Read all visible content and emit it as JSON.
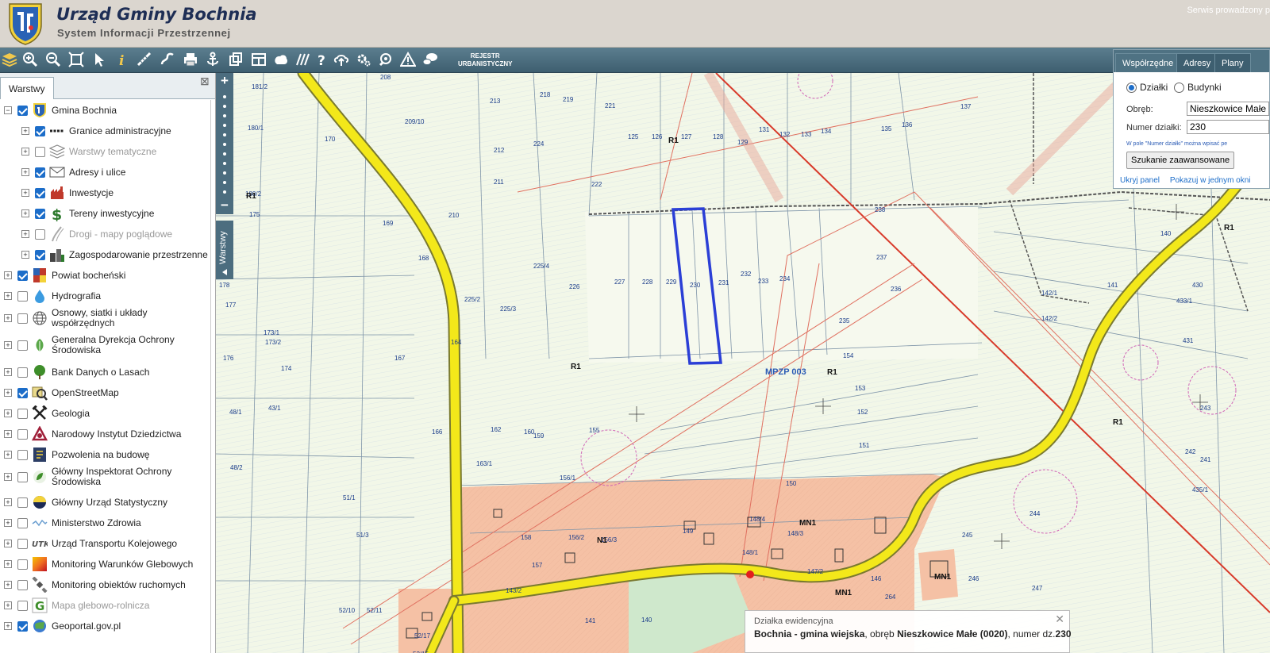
{
  "header": {
    "title": "Urząd Gminy Bochnia",
    "subtitle": "System Informacji Przestrzennej",
    "service_note": "Serwis prowadzony p"
  },
  "toolbar": {
    "tools": [
      "layers-icon",
      "zoom-in-icon",
      "zoom-out-icon",
      "zoom-extent-icon",
      "pointer-icon",
      "info-icon",
      "measure-line-icon",
      "measure-area-icon",
      "print-icon",
      "anchor-icon",
      "copy-icon",
      "table-icon",
      "cloud-shape-icon",
      "hatch-icon",
      "help-icon",
      "upload-cloud-icon",
      "settings-icon",
      "search-map-icon",
      "warning-icon",
      "chat-icon"
    ],
    "registry_line1": "REJESTR",
    "registry_line2": "URBANISTYCZNY"
  },
  "layer_panel": {
    "tab": "Warstwy",
    "close": "⊠",
    "layers": [
      {
        "label": "Gmina Bochnia",
        "checked": true,
        "level": 0,
        "expander": "−",
        "icon": "gmina-crest-icon"
      },
      {
        "label": "Granice administracyjne",
        "checked": true,
        "level": 1,
        "expander": "+",
        "icon": "boundary-line-icon"
      },
      {
        "label": "Warstwy tematyczne",
        "checked": false,
        "level": 1,
        "expander": "+",
        "icon": "layers-stack-icon",
        "grey": true
      },
      {
        "label": "Adresy i ulice",
        "checked": true,
        "level": 1,
        "expander": "+",
        "icon": "envelope-icon"
      },
      {
        "label": "Inwestycje",
        "checked": true,
        "level": 1,
        "expander": "+",
        "icon": "factory-icon"
      },
      {
        "label": "Tereny inwestycyjne",
        "checked": true,
        "level": 1,
        "expander": "+",
        "icon": "dollar-icon"
      },
      {
        "label": "Drogi - mapy poglądowe",
        "checked": false,
        "level": 1,
        "expander": "+",
        "icon": "road-icon",
        "grey": true
      },
      {
        "label": "Zagospodarowanie przestrzenne",
        "checked": true,
        "level": 1,
        "expander": "+",
        "icon": "buildings-icon"
      },
      {
        "label": "Powiat bocheński",
        "checked": true,
        "level": 0,
        "expander": "+",
        "icon": "powiat-crest-icon"
      },
      {
        "label": "Hydrografia",
        "checked": false,
        "level": 0,
        "expander": "+",
        "icon": "water-drop-icon"
      },
      {
        "label": "Osnowy, siatki i układy współrzędnych",
        "checked": false,
        "level": 0,
        "expander": "+",
        "icon": "globe-grid-icon"
      },
      {
        "label": "Generalna Dyrekcja Ochrony Środowiska",
        "checked": false,
        "level": 0,
        "expander": "+",
        "icon": "leaf-icon"
      },
      {
        "label": "Bank Danych o Lasach",
        "checked": false,
        "level": 0,
        "expander": "+",
        "icon": "tree-icon"
      },
      {
        "label": "OpenStreetMap",
        "checked": true,
        "level": 0,
        "expander": "+",
        "icon": "map-magnifier-icon"
      },
      {
        "label": "Geologia",
        "checked": false,
        "level": 0,
        "expander": "+",
        "icon": "hammers-icon"
      },
      {
        "label": "Narodowy Instytut Dziedzictwa",
        "checked": false,
        "level": 0,
        "expander": "+",
        "icon": "heritage-icon"
      },
      {
        "label": "Pozwolenia na budowę",
        "checked": false,
        "level": 0,
        "expander": "+",
        "icon": "permit-icon"
      },
      {
        "label": "Główny Inspektorat Ochrony Środowiska",
        "checked": false,
        "level": 0,
        "expander": "+",
        "icon": "gios-icon"
      },
      {
        "label": "Główny Urząd Statystyczny",
        "checked": false,
        "level": 0,
        "expander": "+",
        "icon": "gus-icon"
      },
      {
        "label": "Ministerstwo Zdrowia",
        "checked": false,
        "level": 0,
        "expander": "+",
        "icon": "wave-icon"
      },
      {
        "label": "Urząd Transportu Kolejowego",
        "checked": false,
        "level": 0,
        "expander": "+",
        "icon": "rail-icon"
      },
      {
        "label": "Monitoring Warunków Glebowych",
        "checked": false,
        "level": 0,
        "expander": "+",
        "icon": "soil-gradient-icon"
      },
      {
        "label": "Monitoring obiektów ruchomych",
        "checked": false,
        "level": 0,
        "expander": "+",
        "icon": "satellite-icon"
      },
      {
        "label": "Mapa glebowo-rolnicza",
        "checked": false,
        "level": 0,
        "expander": "+",
        "icon": "g-letter-icon",
        "grey": true
      },
      {
        "label": "Geoportal.gov.pl",
        "checked": true,
        "level": 0,
        "expander": "+",
        "icon": "geoportal-icon"
      }
    ]
  },
  "map": {
    "zoom_in": "+",
    "zoom_out": "−",
    "layers_handle": "Warstwy",
    "mpzp_label": "MPZP 003",
    "zones": [
      "R1",
      "R1",
      "R1",
      "R1",
      "R1",
      "R1",
      "N1",
      "MN1",
      "MN1",
      "MN1"
    ],
    "parcels": [
      "208",
      "181/2",
      "180/1",
      "180/2",
      "213",
      "218",
      "219",
      "221",
      "209/10",
      "212",
      "211",
      "210",
      "170",
      "175",
      "169",
      "168",
      "167",
      "164",
      "125",
      "126",
      "127",
      "128",
      "129",
      "131",
      "132",
      "133",
      "134",
      "135",
      "136",
      "137",
      "222",
      "224",
      "225/4",
      "225/2",
      "225/3",
      "226",
      "227",
      "228",
      "229",
      "230",
      "231",
      "232",
      "233",
      "234",
      "235",
      "236",
      "237",
      "238",
      "154",
      "153",
      "152",
      "151",
      "155",
      "159",
      "160",
      "162",
      "163/1",
      "166",
      "173/2",
      "173/1",
      "174",
      "176",
      "177",
      "178",
      "48/1",
      "48/2",
      "43/1",
      "51/1",
      "51/3",
      "52/10",
      "52/11",
      "52/17",
      "52/15",
      "156/1",
      "150",
      "158",
      "156/2",
      "156/3",
      "149",
      "148/4",
      "148/3",
      "148/1",
      "147/2",
      "157",
      "143/2",
      "146",
      "141",
      "140",
      "245",
      "246",
      "244",
      "247",
      "243",
      "242",
      "241",
      "140",
      "141",
      "430",
      "433/1",
      "431",
      "142/1",
      "142/2",
      "435/1",
      "264"
    ]
  },
  "search_panel": {
    "tabs": [
      "Współrzędne",
      "Adresy",
      "Plany"
    ],
    "radio_parcels": "Działki",
    "radio_buildings": "Budynki",
    "obreb_label": "Obręb:",
    "obreb_value": "Nieszkowice Małe",
    "parcel_label": "Numer działki:",
    "parcel_value": "230",
    "hint": "W pole \"Numer działki\" można wpisać pe",
    "advanced_button": "Szukanie zaawansowane",
    "hide_link": "Ukryj panel",
    "single_window_link": "Pokazuj w jednym okni"
  },
  "popup": {
    "title": "Działka ewidencyjna",
    "close": "✕",
    "gmina": "Bochnia - gmina wiejska",
    "obreb_prefix": ", obręb ",
    "obreb": "Nieszkowice Małe (0020)",
    "number_prefix": ", numer dz.",
    "number": "230"
  },
  "colors": {
    "header_bg": "#dbd6cf",
    "toolbar_bg": "#4c6d7f",
    "selected_parcel": "#2b3fd6",
    "road_yellow": "#f3e81a",
    "residential_zone": "#f5c1a5",
    "agricultural_zone": "#f2f7e8"
  }
}
